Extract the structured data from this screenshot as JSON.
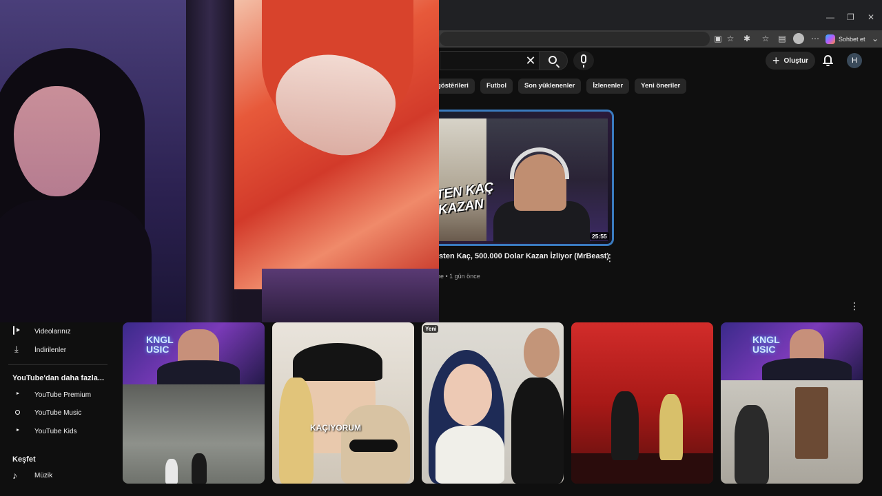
{
  "window": {
    "minimize": "—",
    "restore": "❐",
    "close": "✕"
  },
  "browser": {
    "copilot_label": "Sohbet et",
    "more": "⋯",
    "menu": "⌄"
  },
  "search": {
    "clear_icon": "✕"
  },
  "header": {
    "create_label": "Oluştur",
    "avatar_letter": "H"
  },
  "chips": [
    "göstērileri",
    "Futbol",
    "Son yüklenenler",
    "İzlenenler",
    "Yeni öneriler"
  ],
  "featured_video": {
    "thumbnail_text": "TEN KAÇ\nKAZAN",
    "duration": "25:55",
    "title": "isten Kaç, 500.000 Dolar Kazan İzliyor (MrBeast)",
    "meta": "ne • 1 gün önce",
    "more": "⋮"
  },
  "section_more": "⋮",
  "sidebar": {
    "items_top": [
      {
        "label": "Videolarınız",
        "icon": "video-icon"
      },
      {
        "label": "İndirilenler",
        "icon": "download-icon"
      }
    ],
    "more_from_youtube_heading": "YouTube'dan daha fazla...",
    "more_from_youtube": [
      {
        "label": "YouTube Premium",
        "icon": "youtube-premium-icon"
      },
      {
        "label": "YouTube Music",
        "icon": "youtube-music-icon"
      },
      {
        "label": "YouTube Kids",
        "icon": "youtube-kids-icon"
      }
    ],
    "explore_heading": "Keşfet",
    "explore": [
      {
        "label": "Müzik",
        "icon": "music-note-icon"
      }
    ]
  },
  "shorts": {
    "badge_new": "Yeni",
    "neon_1": "KNGL\nUSIC",
    "neon_5": "KNGL\nUSIC",
    "caption_2": "KAÇIYORUM"
  },
  "colors": {
    "background": "#0f0f0f",
    "chip": "#272727",
    "accent_blue": "#3a7bbf",
    "youtube_red": "#ff0033"
  }
}
